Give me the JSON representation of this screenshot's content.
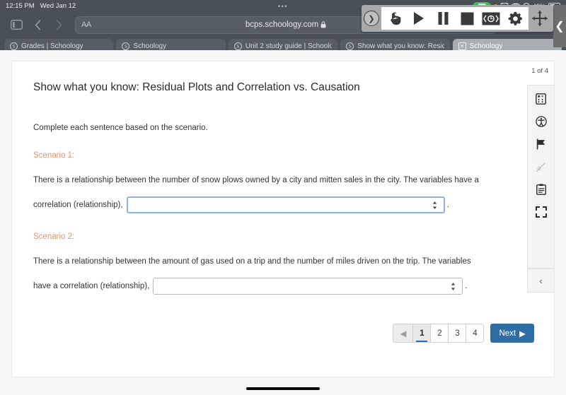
{
  "status_bar": {
    "time": "12:15 PM",
    "date": "Wed Jan 12",
    "center_dots": "•••",
    "battery_percent": "49%",
    "recording_icon": "screen-record-pill",
    "indicator_icons": [
      "orange-dot",
      "wifi-icon",
      "keyboard-icon",
      "headphones-icon"
    ]
  },
  "browser": {
    "sidebar_icon": "sidebar-toggle-icon",
    "back_icon": "chevron-left-icon",
    "forward_icon": "chevron-right-icon",
    "text_size_label": "AA",
    "url": "bcps.schoology.com",
    "lock_icon": "lock-icon",
    "extensions_icon": "puzzle-extension-icon",
    "reload_icon": "reload-icon",
    "share_icon": "share-icon",
    "new_tab_icon": "plus-icon",
    "tab_overview_icon": "tab-grid-icon",
    "tabs": [
      {
        "label": "Grades | Schoology",
        "favicon": "S",
        "active": false
      },
      {
        "label": "Schoology",
        "favicon": "S",
        "active": false
      },
      {
        "label": "Unit 2 study guide | Schoolo",
        "favicon": "S",
        "active": false
      },
      {
        "label": "Show what you know: Resid",
        "favicon": "S",
        "active": false
      },
      {
        "label": "Schoology",
        "favicon": "✕",
        "active": true
      }
    ]
  },
  "overlay_toolbar": {
    "handle_icon": "chevron-right-circle-icon",
    "buttons": [
      {
        "name": "hand-pointer-icon"
      },
      {
        "name": "play-icon"
      },
      {
        "name": "pause-icon"
      },
      {
        "name": "stop-icon"
      },
      {
        "name": "speed-control-icon"
      },
      {
        "name": "gear-icon"
      },
      {
        "name": "move-arrows-icon"
      }
    ],
    "edge_collapse_icon": "chevron-left-icon"
  },
  "page": {
    "title": "Show what you know: Residual Plots and Correlation vs. Causation",
    "instructions": "Complete each sentence based on the scenario.",
    "page_counter": "1 of 4",
    "scenarios": [
      {
        "heading": "Scenario 1:",
        "text_before": "There is a relationship between the number of snow plows owned by a city and mitten sales in the city. The variables have a",
        "text_lead": "correlation (relationship),",
        "select_value": "",
        "select_placeholder": "",
        "focused": true,
        "trailing": "."
      },
      {
        "heading": "Scenario 2:",
        "text_before": "There is a relationship between the amount of gas used on a trip and the number of miles driven on the trip. The variables",
        "text_lead": "have a correlation (relationship),",
        "select_value": "",
        "select_placeholder": "",
        "focused": false,
        "trailing": "."
      }
    ],
    "rail_icons": [
      {
        "name": "calculator-icon"
      },
      {
        "name": "accessibility-icon"
      },
      {
        "name": "flag-icon"
      },
      {
        "name": "strikethrough-tool-icon",
        "disabled": true
      },
      {
        "name": "notepad-icon"
      },
      {
        "name": "fullscreen-icon"
      }
    ],
    "rail_collapse_icon": "chevron-left-icon"
  },
  "pagination": {
    "prev_icon": "triangle-left-icon",
    "pages": [
      "1",
      "2",
      "3",
      "4"
    ],
    "current_page": "1",
    "next_label": "Next",
    "next_icon": "triangle-right-icon"
  },
  "colors": {
    "accent_blue": "#2f6ea5",
    "scenario_orange": "#e8926b",
    "chrome_gray": "#4a5058",
    "focus_blue": "#8ab4e8"
  }
}
